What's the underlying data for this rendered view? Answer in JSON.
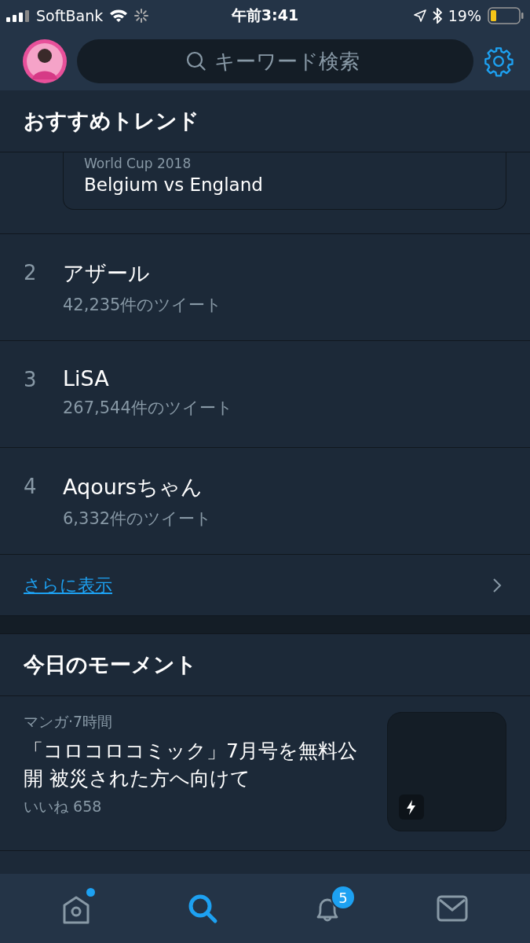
{
  "status_bar": {
    "carrier": "SoftBank",
    "time": "午前3:41",
    "battery": "19%"
  },
  "search": {
    "placeholder": "キーワード検索"
  },
  "trends": {
    "title": "おすすめトレンド",
    "card": {
      "subtitle": "World Cup 2018",
      "title": "Belgium vs England"
    },
    "items": [
      {
        "rank": "2",
        "name": "アザール",
        "count": "42,235件のツイート"
      },
      {
        "rank": "3",
        "name": "LiSA",
        "count": "267,544件のツイート"
      },
      {
        "rank": "4",
        "name": "Aqoursちゃん",
        "count": "6,332件のツイート"
      }
    ],
    "show_more": "さらに表示"
  },
  "moments": {
    "title": "今日のモーメント",
    "items": [
      {
        "meta": "マンガ·7時間",
        "title": "「コロコロコミック」7月号を無料公開 被災された方へ向けて",
        "likes": "いいね 658"
      }
    ]
  },
  "tab_bar": [
    {
      "kind": "home",
      "selected": false,
      "dot": true
    },
    {
      "kind": "search",
      "selected": true,
      "dot": false
    },
    {
      "kind": "notifications",
      "selected": false,
      "dot": false,
      "badge": "5"
    },
    {
      "kind": "messages",
      "selected": false,
      "dot": false
    }
  ]
}
